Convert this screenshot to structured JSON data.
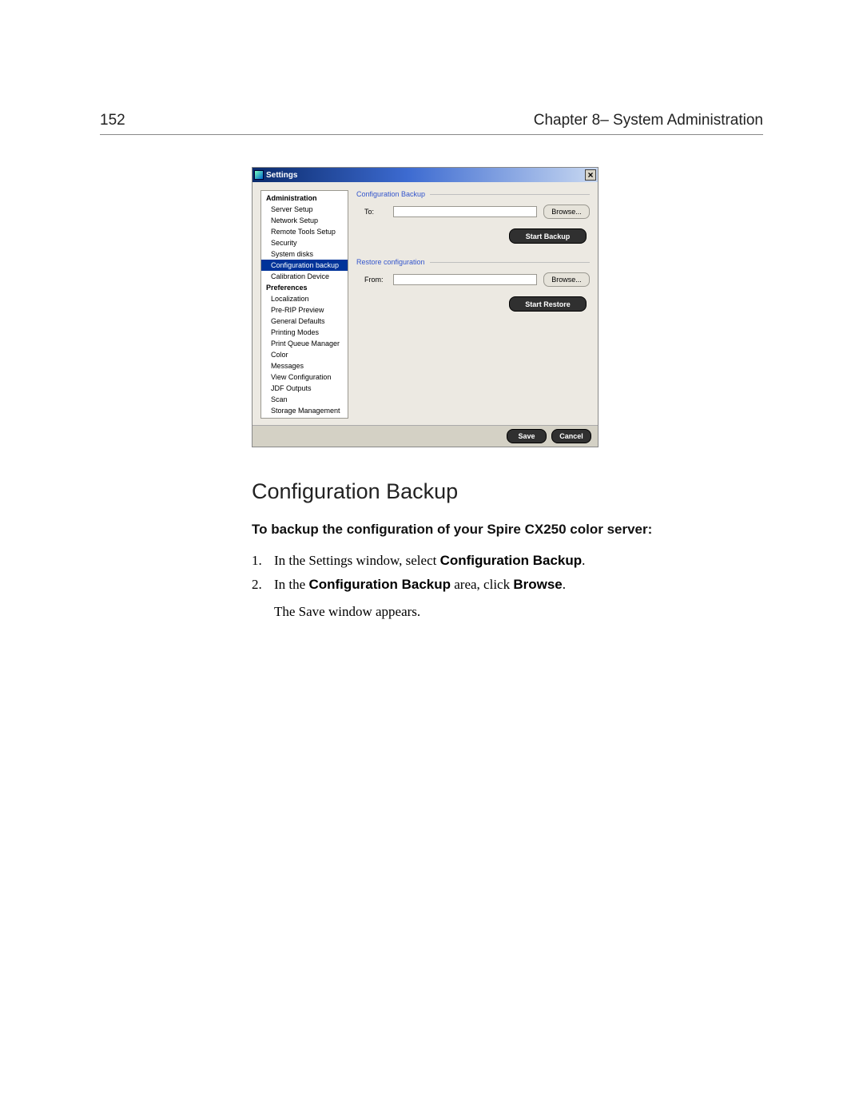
{
  "page": {
    "number": "152",
    "chapter": "Chapter 8– System Administration"
  },
  "settings_window": {
    "title": "Settings",
    "sidebar": {
      "groups": [
        {
          "header": "Administration",
          "items": [
            "Server Setup",
            "Network Setup",
            "Remote Tools Setup",
            "Security",
            "System disks",
            "Configuration backup",
            "Calibration Device"
          ],
          "selected_index": 5
        },
        {
          "header": "Preferences",
          "items": [
            "Localization",
            "Pre-RIP Preview",
            "General Defaults",
            "Printing Modes",
            "Print Queue Manager",
            "Color",
            "Messages",
            "View Configuration",
            "JDF Outputs",
            "Scan",
            "Storage Management"
          ],
          "selected_index": -1
        }
      ]
    },
    "backup_section": {
      "title": "Configuration Backup",
      "to_label": "To:",
      "to_value": "",
      "browse": "Browse...",
      "start": "Start Backup"
    },
    "restore_section": {
      "title": "Restore configuration",
      "from_label": "From:",
      "from_value": "",
      "browse": "Browse...",
      "start": "Start Restore"
    },
    "footer": {
      "save": "Save",
      "cancel": "Cancel"
    }
  },
  "body_text": {
    "heading": "Configuration Backup",
    "subheading": "To backup the configuration of your Spire CX250 color server:",
    "steps": [
      {
        "num": "1.",
        "pre": "In the Settings window, select ",
        "bold": "Configuration Backup",
        "post": "."
      },
      {
        "num": "2.",
        "pre": "In the ",
        "bold": "Configuration Backup",
        "mid": " area, click ",
        "bold2": "Browse",
        "post": ".",
        "cont": "The Save window appears."
      }
    ]
  }
}
